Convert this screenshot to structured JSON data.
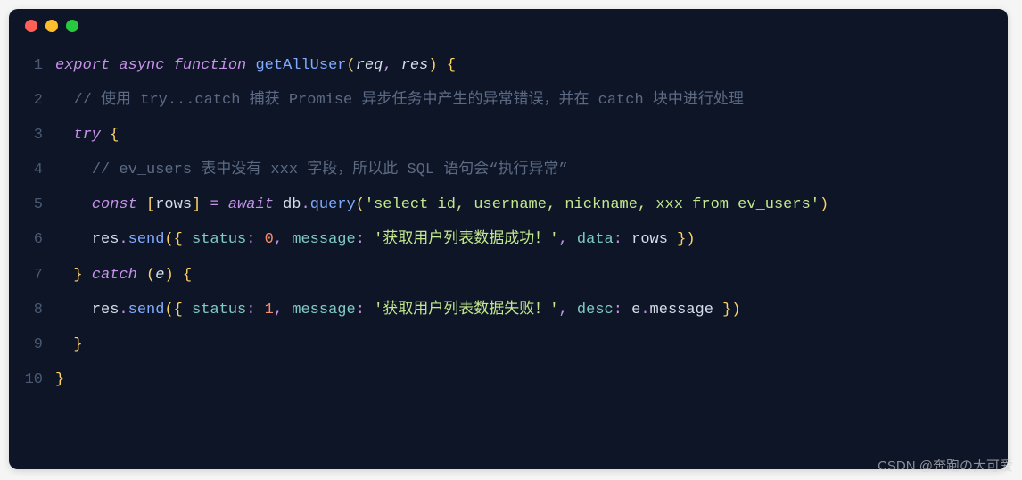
{
  "window": {
    "dots": [
      "red",
      "yellow",
      "green"
    ]
  },
  "code": {
    "lines": [
      {
        "n": "1",
        "tokens": [
          {
            "cls": "kw",
            "t": "export"
          },
          {
            "cls": "id",
            "t": " "
          },
          {
            "cls": "kw",
            "t": "async"
          },
          {
            "cls": "id",
            "t": " "
          },
          {
            "cls": "kw",
            "t": "function"
          },
          {
            "cls": "id",
            "t": " "
          },
          {
            "cls": "fn",
            "t": "getAllUser"
          },
          {
            "cls": "brk",
            "t": "("
          },
          {
            "cls": "param",
            "t": "req"
          },
          {
            "cls": "pun",
            "t": ","
          },
          {
            "cls": "id",
            "t": " "
          },
          {
            "cls": "param",
            "t": "res"
          },
          {
            "cls": "brk",
            "t": ")"
          },
          {
            "cls": "id",
            "t": " "
          },
          {
            "cls": "brk",
            "t": "{"
          }
        ]
      },
      {
        "n": "2",
        "tokens": [
          {
            "cls": "id",
            "t": "  "
          },
          {
            "cls": "cmt",
            "t": "// 使用 try...catch 捕获 Promise 异步任务中产生的异常错误，并在 catch 块中进行处理"
          }
        ]
      },
      {
        "n": "3",
        "tokens": [
          {
            "cls": "id",
            "t": "  "
          },
          {
            "cls": "kw",
            "t": "try"
          },
          {
            "cls": "id",
            "t": " "
          },
          {
            "cls": "brk",
            "t": "{"
          }
        ]
      },
      {
        "n": "4",
        "tokens": [
          {
            "cls": "id",
            "t": "    "
          },
          {
            "cls": "cmt",
            "t": "// ev_users 表中没有 xxx 字段，所以此 SQL 语句会“执行异常”"
          }
        ]
      },
      {
        "n": "5",
        "tokens": [
          {
            "cls": "id",
            "t": "    "
          },
          {
            "cls": "kw",
            "t": "const"
          },
          {
            "cls": "id",
            "t": " "
          },
          {
            "cls": "brk",
            "t": "["
          },
          {
            "cls": "id",
            "t": "rows"
          },
          {
            "cls": "brk",
            "t": "]"
          },
          {
            "cls": "id",
            "t": " "
          },
          {
            "cls": "pun",
            "t": "="
          },
          {
            "cls": "id",
            "t": " "
          },
          {
            "cls": "kw",
            "t": "await"
          },
          {
            "cls": "id",
            "t": " "
          },
          {
            "cls": "id",
            "t": "db"
          },
          {
            "cls": "dot-op",
            "t": "."
          },
          {
            "cls": "fn",
            "t": "query"
          },
          {
            "cls": "brk",
            "t": "("
          },
          {
            "cls": "str",
            "t": "'select id, username, nickname, xxx from ev_users'"
          },
          {
            "cls": "brk",
            "t": ")"
          }
        ]
      },
      {
        "n": "6",
        "tokens": [
          {
            "cls": "id",
            "t": "    "
          },
          {
            "cls": "id",
            "t": "res"
          },
          {
            "cls": "dot-op",
            "t": "."
          },
          {
            "cls": "fn",
            "t": "send"
          },
          {
            "cls": "brk",
            "t": "("
          },
          {
            "cls": "brk",
            "t": "{"
          },
          {
            "cls": "id",
            "t": " "
          },
          {
            "cls": "prop",
            "t": "status"
          },
          {
            "cls": "pun",
            "t": ":"
          },
          {
            "cls": "id",
            "t": " "
          },
          {
            "cls": "num",
            "t": "0"
          },
          {
            "cls": "pun",
            "t": ","
          },
          {
            "cls": "id",
            "t": " "
          },
          {
            "cls": "prop",
            "t": "message"
          },
          {
            "cls": "pun",
            "t": ":"
          },
          {
            "cls": "id",
            "t": " "
          },
          {
            "cls": "str",
            "t": "'获取用户列表数据成功！'"
          },
          {
            "cls": "pun",
            "t": ","
          },
          {
            "cls": "id",
            "t": " "
          },
          {
            "cls": "prop",
            "t": "data"
          },
          {
            "cls": "pun",
            "t": ":"
          },
          {
            "cls": "id",
            "t": " "
          },
          {
            "cls": "id",
            "t": "rows"
          },
          {
            "cls": "id",
            "t": " "
          },
          {
            "cls": "brk",
            "t": "}"
          },
          {
            "cls": "brk",
            "t": ")"
          }
        ]
      },
      {
        "n": "7",
        "tokens": [
          {
            "cls": "id",
            "t": "  "
          },
          {
            "cls": "brk",
            "t": "}"
          },
          {
            "cls": "id",
            "t": " "
          },
          {
            "cls": "kw",
            "t": "catch"
          },
          {
            "cls": "id",
            "t": " "
          },
          {
            "cls": "brk",
            "t": "("
          },
          {
            "cls": "param",
            "t": "e"
          },
          {
            "cls": "brk",
            "t": ")"
          },
          {
            "cls": "id",
            "t": " "
          },
          {
            "cls": "brk",
            "t": "{"
          }
        ]
      },
      {
        "n": "8",
        "tokens": [
          {
            "cls": "id",
            "t": "    "
          },
          {
            "cls": "id",
            "t": "res"
          },
          {
            "cls": "dot-op",
            "t": "."
          },
          {
            "cls": "fn",
            "t": "send"
          },
          {
            "cls": "brk",
            "t": "("
          },
          {
            "cls": "brk",
            "t": "{"
          },
          {
            "cls": "id",
            "t": " "
          },
          {
            "cls": "prop",
            "t": "status"
          },
          {
            "cls": "pun",
            "t": ":"
          },
          {
            "cls": "id",
            "t": " "
          },
          {
            "cls": "num",
            "t": "1"
          },
          {
            "cls": "pun",
            "t": ","
          },
          {
            "cls": "id",
            "t": " "
          },
          {
            "cls": "prop",
            "t": "message"
          },
          {
            "cls": "pun",
            "t": ":"
          },
          {
            "cls": "id",
            "t": " "
          },
          {
            "cls": "str",
            "t": "'获取用户列表数据失败！'"
          },
          {
            "cls": "pun",
            "t": ","
          },
          {
            "cls": "id",
            "t": " "
          },
          {
            "cls": "prop",
            "t": "desc"
          },
          {
            "cls": "pun",
            "t": ":"
          },
          {
            "cls": "id",
            "t": " "
          },
          {
            "cls": "id",
            "t": "e"
          },
          {
            "cls": "dot-op",
            "t": "."
          },
          {
            "cls": "id",
            "t": "message"
          },
          {
            "cls": "id",
            "t": " "
          },
          {
            "cls": "brk",
            "t": "}"
          },
          {
            "cls": "brk",
            "t": ")"
          }
        ]
      },
      {
        "n": "9",
        "tokens": [
          {
            "cls": "id",
            "t": "  "
          },
          {
            "cls": "brk",
            "t": "}"
          }
        ]
      },
      {
        "n": "10",
        "tokens": [
          {
            "cls": "brk",
            "t": "}"
          }
        ]
      }
    ]
  },
  "watermark": "CSDN @奔跑の大可爱"
}
